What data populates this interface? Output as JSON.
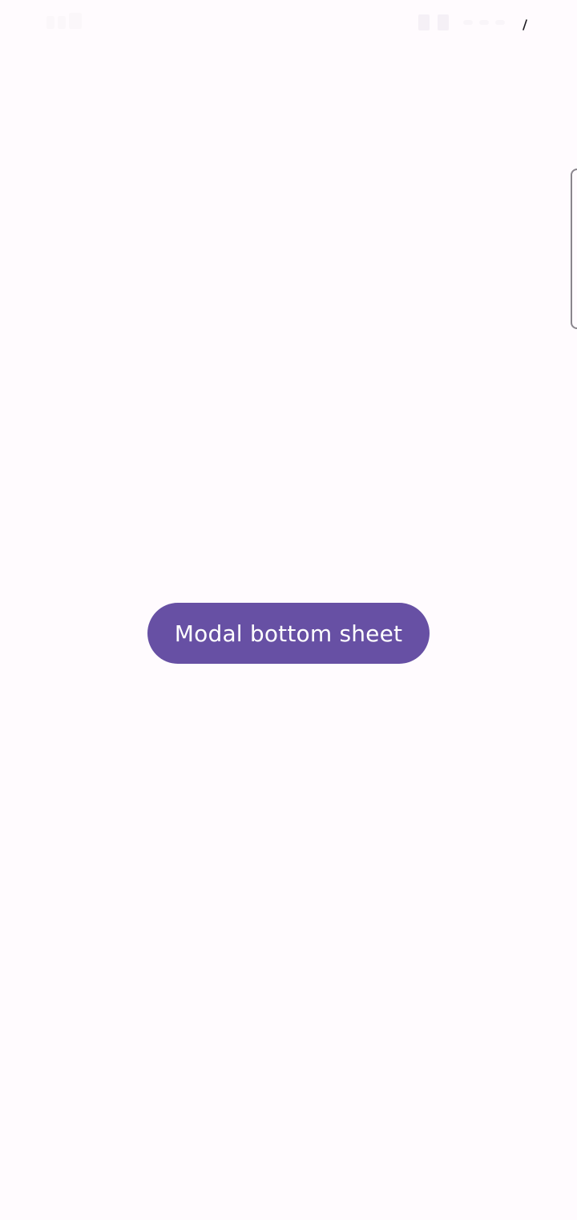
{
  "status_bar": {
    "icons": [
      "status-time-icon",
      "signal-icon",
      "wifi-icon",
      "battery-icon"
    ]
  },
  "main": {
    "modal_button_label": "Modal bottom sheet"
  },
  "colors": {
    "background": "#FFFBFE",
    "primary": "#6750A4",
    "on_primary": "#FFFFFF",
    "handle_outline": "#8A868D"
  }
}
